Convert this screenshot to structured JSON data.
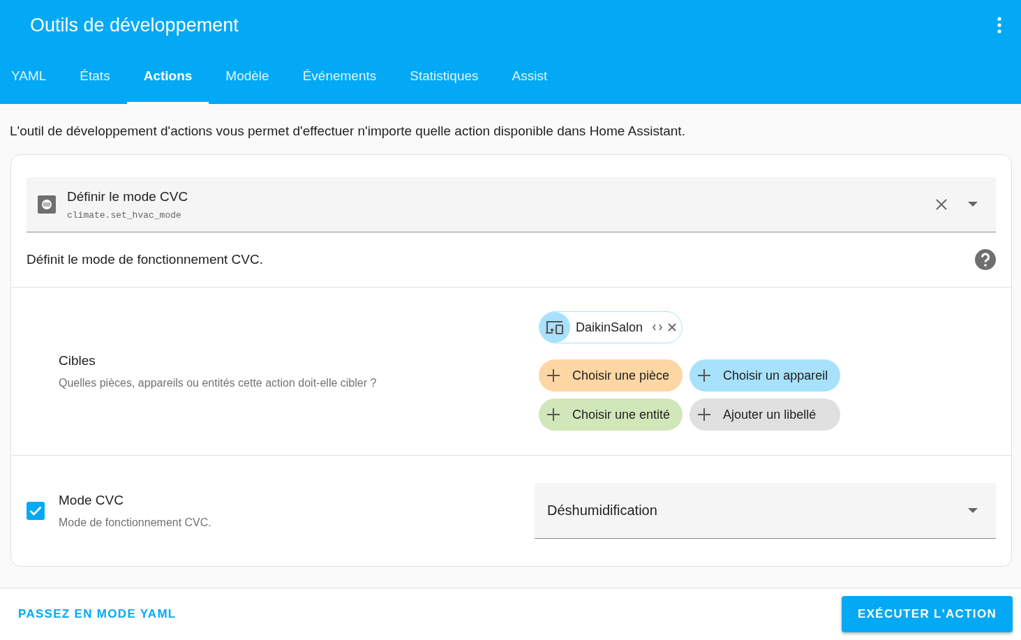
{
  "header": {
    "title": "Outils de développement"
  },
  "tabs": [
    {
      "label": "YAML",
      "selected": false
    },
    {
      "label": "États",
      "selected": false
    },
    {
      "label": "Actions",
      "selected": true
    },
    {
      "label": "Modèle",
      "selected": false
    },
    {
      "label": "Événements",
      "selected": false
    },
    {
      "label": "Statistiques",
      "selected": false
    },
    {
      "label": "Assist",
      "selected": false
    }
  ],
  "intro": "L'outil de développement d'actions vous permet d'effectuer n'importe quelle action disponible dans Home Assistant.",
  "action_picker": {
    "name": "Définir le mode CVC",
    "id": "climate.set_hvac_mode"
  },
  "action_description": "Définit le mode de fonctionnement CVC.",
  "targets": {
    "title": "Cibles",
    "subtitle": "Quelles pièces, appareils ou entités cette action doit-elle cibler ?",
    "chips": [
      {
        "label": "DaikinSalon"
      }
    ],
    "add_buttons": [
      {
        "label": "Choisir une pièce",
        "color": "#fed6a4"
      },
      {
        "label": "Choisir un appareil",
        "color": "#a8e1fb"
      },
      {
        "label": "Choisir une entité",
        "color": "#d2e7b9"
      },
      {
        "label": "Ajouter un libellé",
        "color": "#e0e0e0"
      }
    ]
  },
  "fields": [
    {
      "name": "Mode CVC",
      "description": "Mode de fonctionnement CVC.",
      "checked": true,
      "value": "Déshumidification"
    }
  ],
  "footer": {
    "yaml_button": "PASSEZ EN MODE YAML",
    "run_button": "EXÉCUTER L'ACTION"
  }
}
